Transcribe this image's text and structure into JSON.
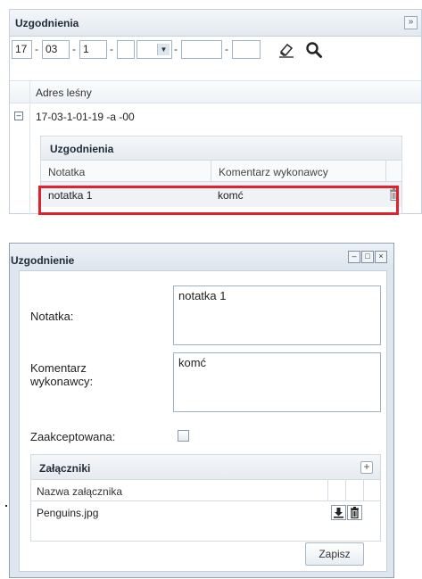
{
  "panel": {
    "title": "Uzgodnienia",
    "collapse_icon": "double-chevron-right-icon",
    "filters": {
      "f1": "17",
      "f2": "03",
      "f3": "1",
      "f4": "",
      "f5": "",
      "f6": "",
      "sep": "-"
    },
    "grid": {
      "column": "Adres leśny",
      "rows": [
        {
          "value": "17-03-1-01-19 -a -00"
        }
      ]
    },
    "sub_grid": {
      "title": "Uzgodnienia",
      "columns": [
        "Notatka",
        "Komentarz wykonawcy"
      ],
      "rows": [
        {
          "notatka": "notatka 1",
          "komentarz": "komć"
        }
      ],
      "highlight_color": "#e0202a"
    }
  },
  "dialog": {
    "title": "Uzgodnienie",
    "window_buttons": {
      "minimize": "–",
      "maximize": "□",
      "close": "×"
    },
    "fields": {
      "notatka_label": "Notatka:",
      "notatka_value": "notatka 1",
      "komentarz_label_1": "Komentarz",
      "komentarz_label_2": "wykonawcy:",
      "komentarz_value": "komć",
      "zaakceptowana_label": "Zaakceptowana:",
      "zaakceptowana_checked": false
    },
    "attachments": {
      "title": "Załączniki",
      "add": "+",
      "column": "Nazwa załącznika",
      "rows": [
        {
          "name": "Penguins.jpg"
        }
      ]
    },
    "save_label": "Zapisz"
  }
}
